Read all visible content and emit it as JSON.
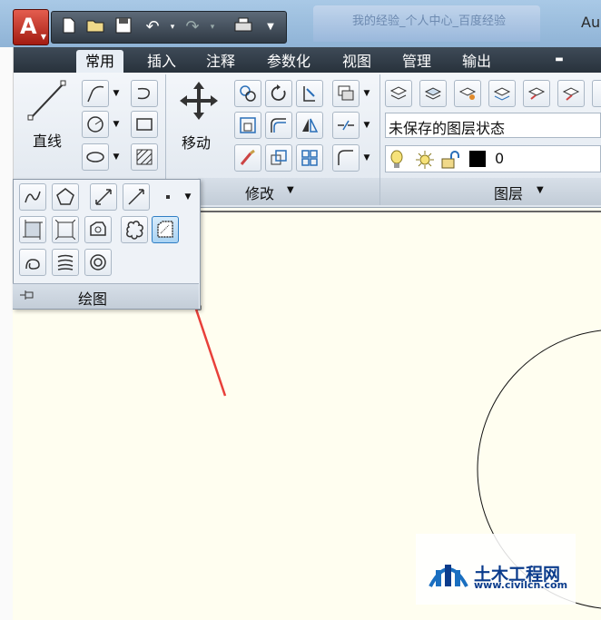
{
  "window": {
    "app_title": "Au",
    "doc_tab_text": "我的经验_个人中心_百度经验"
  },
  "quick_access": {
    "app_menu_icon": "autocad-logo-icon",
    "buttons": [
      "new-icon",
      "open-icon",
      "save-icon",
      "undo-icon",
      "redo-icon",
      "plot-icon",
      "customize-icon"
    ]
  },
  "ribbon_tabs": {
    "items": [
      "常用",
      "插入",
      "注释",
      "参数化",
      "视图",
      "管理",
      "输出"
    ],
    "active": "常用"
  },
  "draw_panel": {
    "line_label": "直线",
    "title": "绘图",
    "tools_row1": [
      "spline-icon",
      "polygon-icon",
      "xline-icon",
      "ray-icon",
      "point-icon"
    ],
    "tools_row2": [
      "hatch-icon",
      "gradient-icon",
      "boundary-icon",
      "revcloud-icon",
      "wipeout-icon"
    ],
    "tools_row3": [
      "helix-icon",
      "table-hatch-icon",
      "donut-icon"
    ],
    "highlighted_tool": "wipeout-icon"
  },
  "modify_panel": {
    "move_label": "移动",
    "title": "修改"
  },
  "layers_panel": {
    "layer_state": "未保存的图层状态",
    "current_layer": "0",
    "title": "图层",
    "layer_color": "#000000"
  },
  "watermark": {
    "brand": "土木工程网",
    "url": "www.civilcn.com"
  },
  "colors": {
    "canvas_bg": "#fffef0",
    "annotation_arrow": "#e8403a",
    "highlight_border": "#2f7ec4"
  }
}
